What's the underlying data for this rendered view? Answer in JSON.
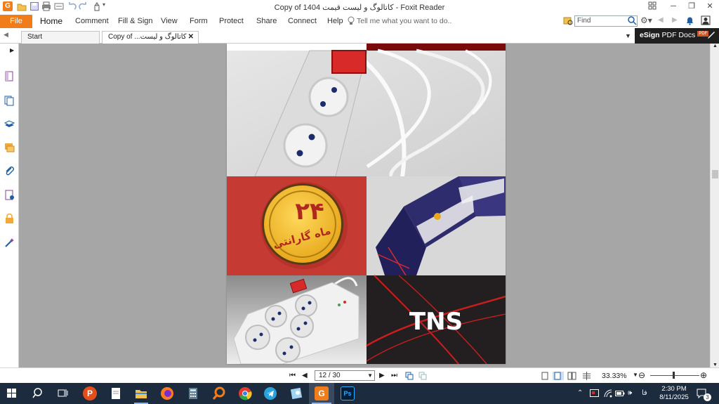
{
  "window": {
    "title": "Copy of 1404 کاتالوگ و لیست قیمت - Foxit Reader"
  },
  "menu": {
    "file": "File",
    "items": [
      "Home",
      "Comment",
      "Fill & Sign",
      "View",
      "Form",
      "Protect",
      "Share",
      "Connect",
      "Help"
    ],
    "tell_me": "Tell me what you want to do..",
    "find_placeholder": "Find"
  },
  "tabs": [
    {
      "label": "Start"
    },
    {
      "label": "Copy of ...کاتالوگ و لیست"
    }
  ],
  "esign": {
    "bold": "eSign",
    "rest": " PDF Docs",
    "badge": "PDF"
  },
  "document": {
    "badge_number": "۲۴",
    "badge_text": "ماه گارانتی",
    "brand_logo": "TNS"
  },
  "status": {
    "page": "12 / 30",
    "zoom": "33.33%"
  },
  "taskbar": {
    "time": "2:30 PM",
    "date": "8/11/2025",
    "language": "فا",
    "notifications": "3"
  },
  "colors": {
    "accent": "#f07d1a",
    "taskbar": "#1d2b3e",
    "doc_bg": "#a6a6a6"
  }
}
